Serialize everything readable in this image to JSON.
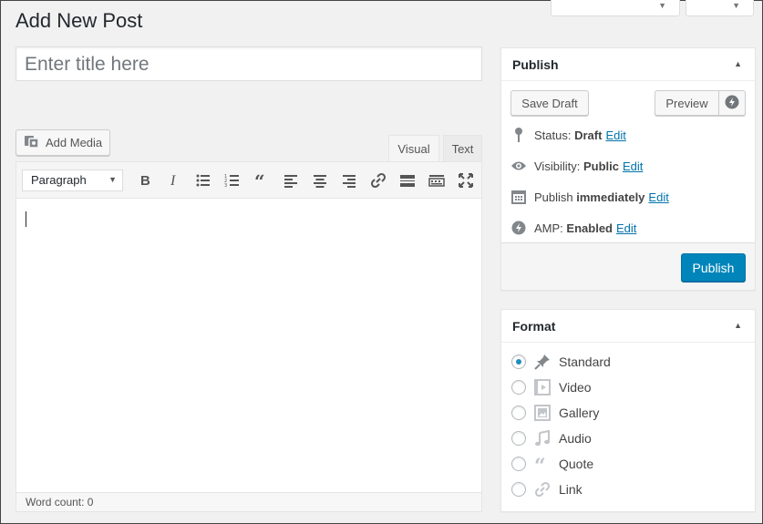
{
  "page": {
    "title": "Add New Post"
  },
  "title_field": {
    "placeholder": "Enter title here"
  },
  "media": {
    "add_media_label": "Add Media"
  },
  "editor": {
    "tabs": [
      {
        "label": "Visual",
        "active": true
      },
      {
        "label": "Text",
        "active": false
      }
    ],
    "format_select": "Paragraph",
    "toolbar_icons": [
      "bold-icon",
      "italic-icon",
      "bullet-list-icon",
      "numbered-list-icon",
      "blockquote-icon",
      "align-left-icon",
      "align-center-icon",
      "align-right-icon",
      "link-icon",
      "read-more-icon",
      "toolbar-toggle-icon",
      "fullscreen-icon"
    ],
    "word_count": "Word count: 0"
  },
  "publish": {
    "heading": "Publish",
    "save_draft": "Save Draft",
    "preview": "Preview",
    "status": {
      "label": "Status:",
      "value": "Draft",
      "edit": "Edit"
    },
    "visibility": {
      "label": "Visibility:",
      "value": "Public",
      "edit": "Edit"
    },
    "schedule": {
      "label": "Publish",
      "value": "immediately",
      "edit": "Edit"
    },
    "amp": {
      "label": "AMP:",
      "value": "Enabled",
      "edit": "Edit"
    },
    "publish_button": "Publish",
    "accent_color": "#0085ba"
  },
  "format": {
    "heading": "Format",
    "options": [
      {
        "label": "Standard",
        "icon": "pin-icon",
        "checked": true
      },
      {
        "label": "Video",
        "icon": "video-icon",
        "checked": false
      },
      {
        "label": "Gallery",
        "icon": "gallery-icon",
        "checked": false
      },
      {
        "label": "Audio",
        "icon": "audio-icon",
        "checked": false
      },
      {
        "label": "Quote",
        "icon": "quote-icon",
        "checked": false
      },
      {
        "label": "Link",
        "icon": "link-icon",
        "checked": false
      }
    ]
  }
}
